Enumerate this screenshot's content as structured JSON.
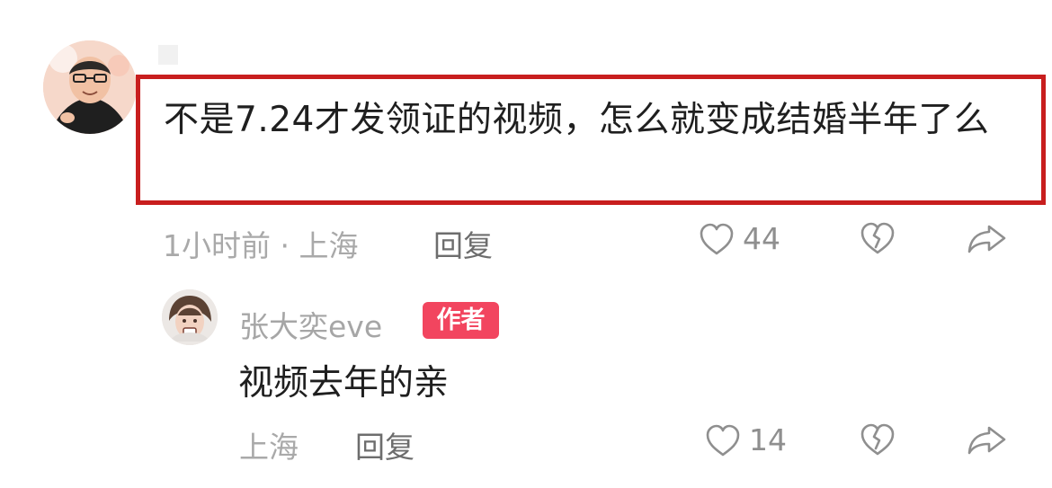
{
  "comment": {
    "text": "不是7.24才发领证的视频，怎么就变成结婚半年了么",
    "time_location": "1小时前 · 上海",
    "reply_label": "回复",
    "like_count": "44"
  },
  "reply": {
    "username": "张大奕eve",
    "author_badge": "作者",
    "text": "视频去年的亲",
    "location": "上海",
    "reply_label": "回复",
    "like_count": "14"
  },
  "colors": {
    "highlight_border": "#c81e1e",
    "author_badge_bg": "#f2455f",
    "meta_gray": "#a9a9a9"
  }
}
